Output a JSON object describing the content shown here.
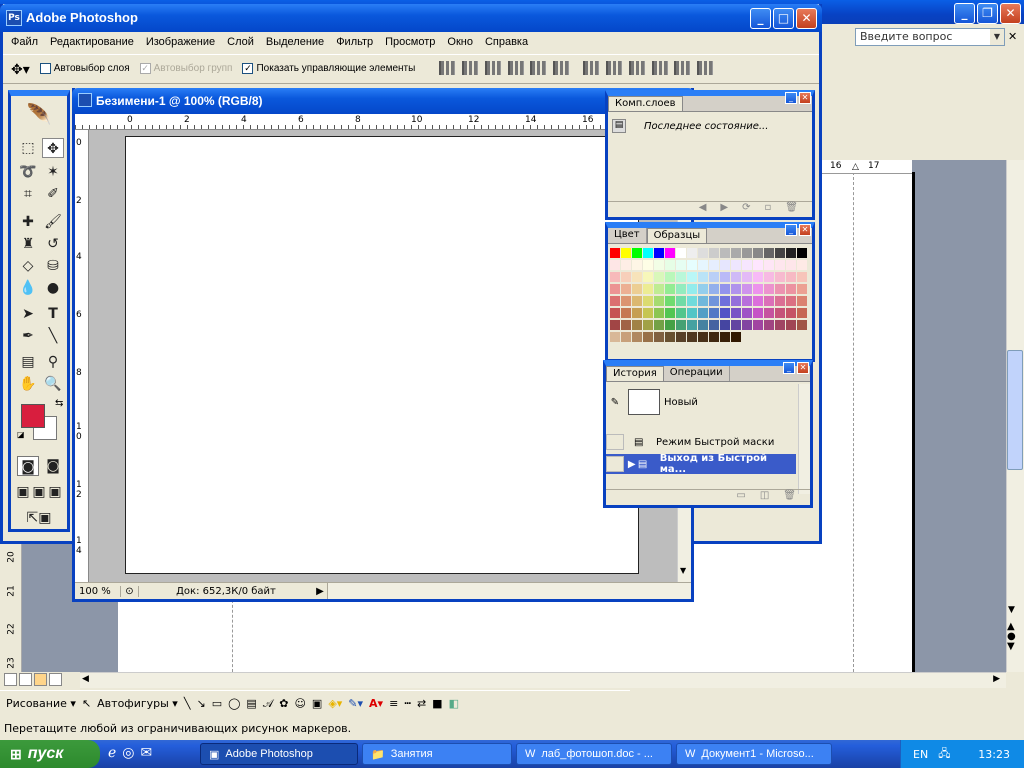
{
  "word": {
    "ask_placeholder": "Введите вопрос",
    "hruler_labels": [
      "16",
      "17"
    ],
    "vruler_labels": [
      "20",
      "21",
      "22",
      "23"
    ],
    "draw_label": "Рисование",
    "autoshapes_label": "Автофигуры",
    "status_text": "Перетащите любой из ограничивающих рисунок маркеров."
  },
  "photoshop": {
    "title": "Adobe Photoshop",
    "menu": [
      "Файл",
      "Редактирование",
      "Изображение",
      "Слой",
      "Выделение",
      "Фильтр",
      "Просмотр",
      "Окно",
      "Справка"
    ],
    "options": {
      "auto_select_layer": "Автовыбор слоя",
      "auto_select_groups": "Автовыбор групп",
      "show_controls": "Показать управляющие элементы"
    },
    "document": {
      "title": "Безимени-1 @ 100% (RGB/8)",
      "ruler_h": [
        "0",
        "2",
        "4",
        "6",
        "8",
        "10",
        "12",
        "14",
        "16"
      ],
      "ruler_v": [
        "0",
        "2",
        "4",
        "6",
        "8",
        "1 0",
        "1 2",
        "1 4"
      ],
      "zoom": "100 %",
      "doc_info": "Док: 652,3К/0 байт"
    },
    "layer_comps": {
      "tab": "Комп.слоев",
      "row": "Последнее состояние..."
    },
    "swatches": {
      "tabs": [
        "Цвет",
        "Образцы"
      ]
    },
    "history": {
      "tabs": [
        "История",
        "Операции"
      ],
      "snapshot": "Новый",
      "items": [
        "Режим Быстрой маски",
        "Выход из Быстрой ма..."
      ]
    },
    "colors": {
      "foreground": "#d81e3e",
      "background": "#ffffff"
    }
  },
  "taskbar": {
    "start": "пуск",
    "tasks": [
      "Adobe Photoshop",
      "Занятия",
      "лаб_фотошоп.doc - ...",
      "Документ1 - Microso..."
    ],
    "lang": "EN",
    "clock": "13:23"
  }
}
